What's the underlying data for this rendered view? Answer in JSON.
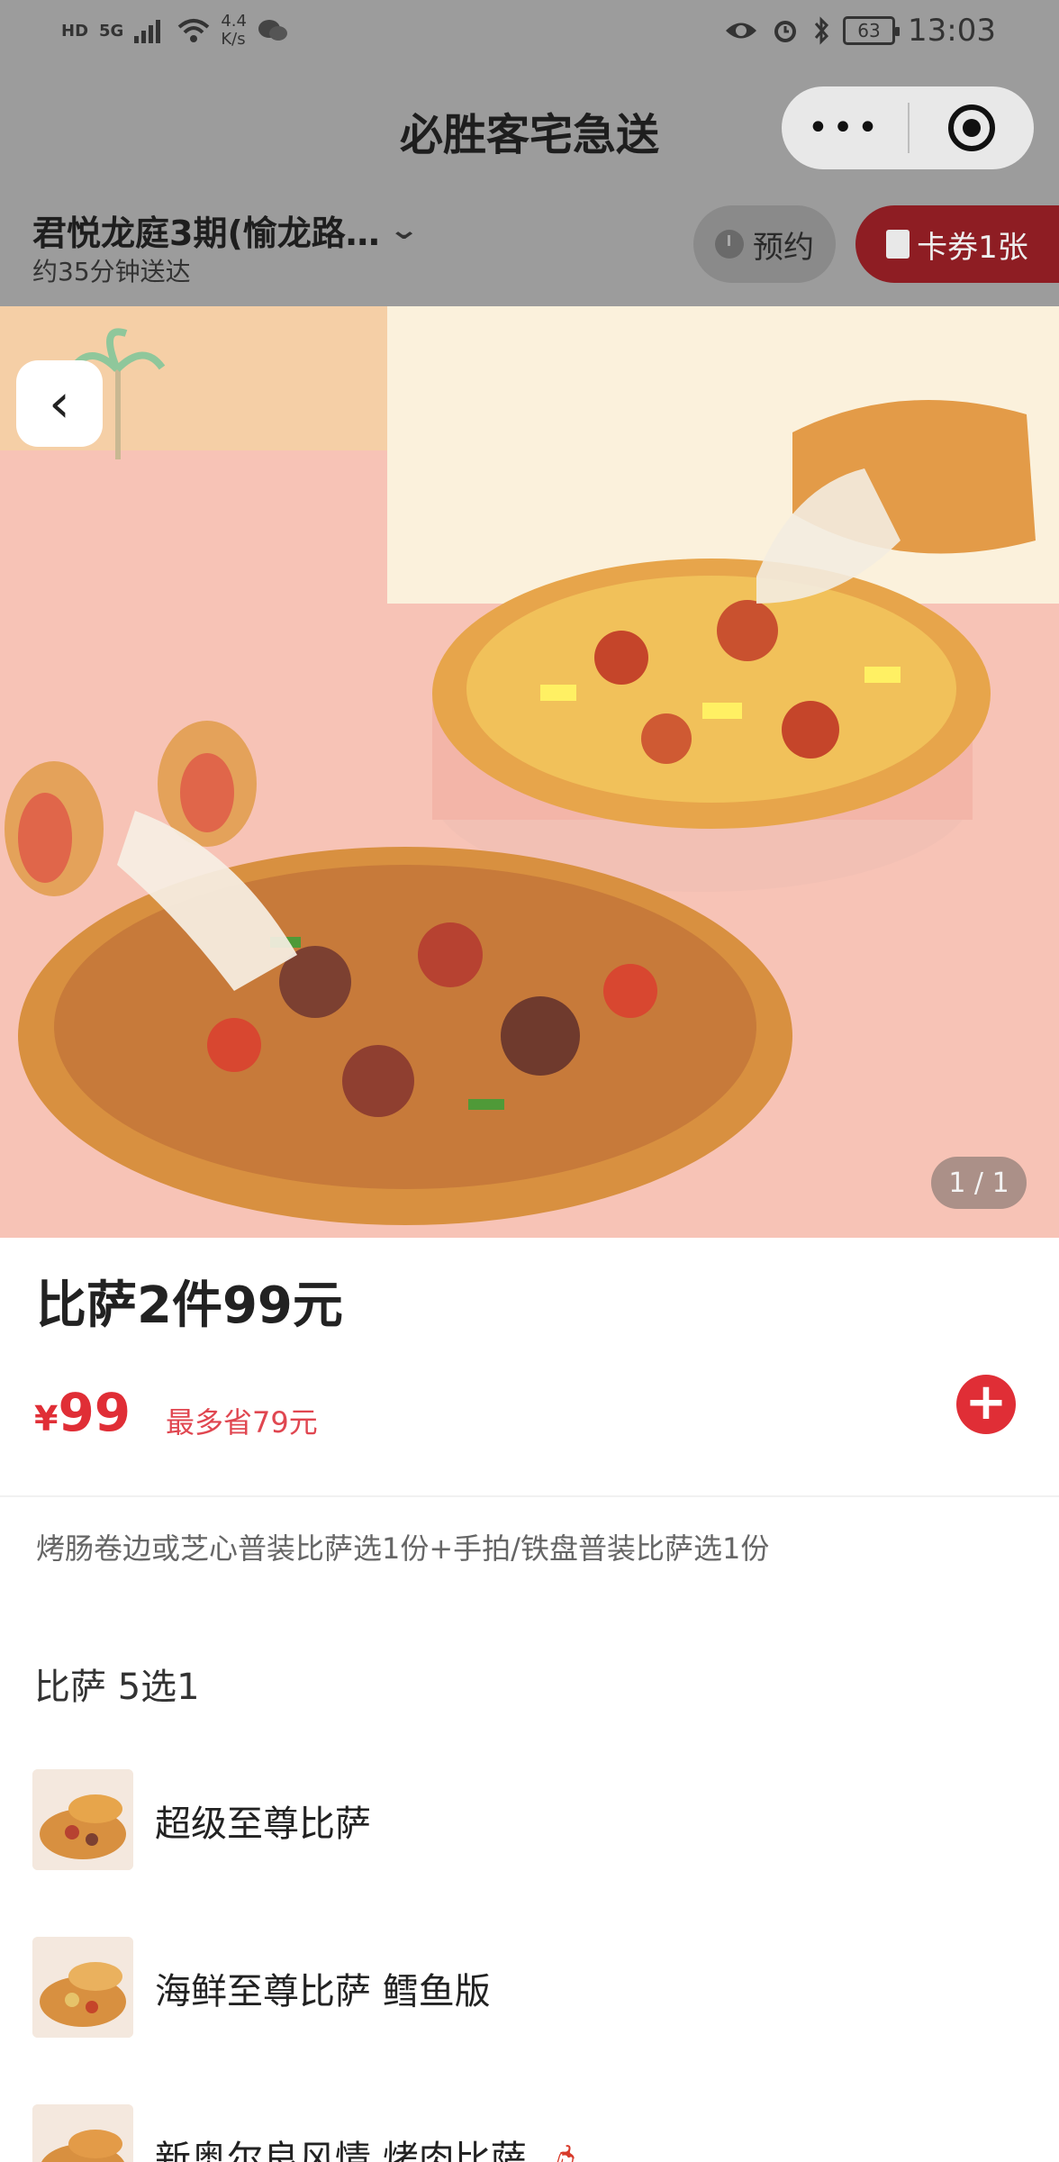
{
  "status_bar": {
    "network_hd": "HD",
    "network_type": "5G",
    "speed_value": "4.4",
    "speed_unit": "K/s",
    "battery": "63",
    "time": "13:03"
  },
  "title_bar": {
    "title": "必胜客宅急送",
    "more_label": "•••"
  },
  "address_bar": {
    "address": "君悦龙庭3期(愉龙路…",
    "eta": "约35分钟送达",
    "reserve_label": "预约",
    "coupon_label": "卡券1张"
  },
  "hero": {
    "pager": "1 / 1",
    "back_glyph": "‹"
  },
  "product": {
    "title": "比萨2件99元",
    "currency": "¥",
    "price": "99",
    "save_text": "最多省79元",
    "add_glyph": "+",
    "description": "烤肠卷边或芝心普装比萨选1份+手拍/铁盘普装比萨选1份"
  },
  "section": {
    "title": "比萨 5选1",
    "items": [
      {
        "name": "超级至尊比萨"
      },
      {
        "name": "海鲜至尊比萨 鳕鱼版"
      },
      {
        "name": "新奥尔良风情 烤肉比萨"
      }
    ]
  },
  "colors": {
    "accent_red": "#e02e36",
    "overlay_grey": "#9c9c9c",
    "coupon_dark_red": "#8e1d23"
  }
}
